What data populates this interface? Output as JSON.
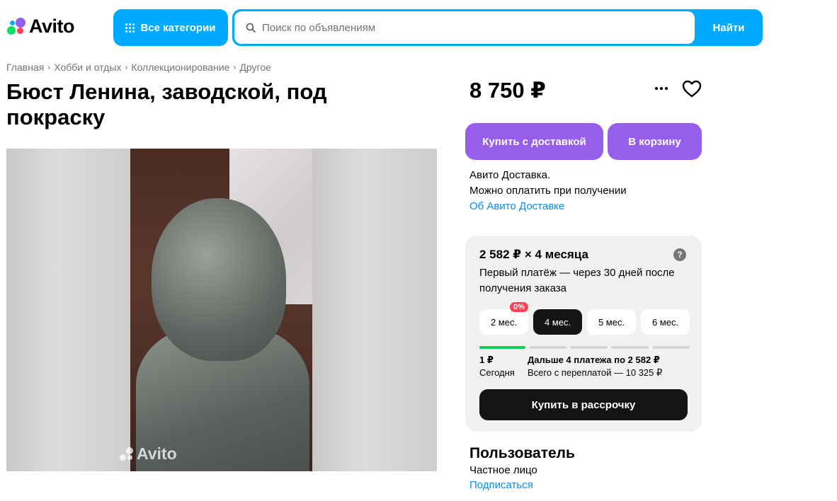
{
  "header": {
    "logo_text": "Avito",
    "categories_label": "Все категории",
    "search_placeholder": "Поиск по объявлениям",
    "find_label": "Найти",
    "accent_color": "#00aaff"
  },
  "breadcrumbs": [
    "Главная",
    "Хобби и отдых",
    "Коллекционирование",
    "Другое"
  ],
  "listing": {
    "title": "Бюст Ленина, заводской, под покраску",
    "price": "8 750 ₽",
    "photo_watermark": "Avito"
  },
  "actions": {
    "buy_delivery_label": "Купить с доставкой",
    "cart_label": "В корзину",
    "purple_color": "#965eeb"
  },
  "delivery": {
    "line1": "Авито Доставка.",
    "line2": "Можно оплатить при получении",
    "link": "Об Авито Доставке"
  },
  "installment": {
    "title": "2 582 ₽ × 4 месяца",
    "subtitle": "Первый платёж — через 30 дней после получения заказа",
    "help_icon_glyph": "?",
    "tabs": [
      {
        "label": "2 мес.",
        "badge": "0%"
      },
      {
        "label": "4 мес."
      },
      {
        "label": "5 мес."
      },
      {
        "label": "6 мес."
      }
    ],
    "active_tab": "4 мес.",
    "first_amount": "1 ₽",
    "first_when": "Сегодня",
    "rest_title": "Дальше 4 платежа по 2 582 ₽",
    "rest_total": "Всего с переплатой — 10 325 ₽",
    "buy_label": "Купить в рассрочку"
  },
  "seller": {
    "name": "Пользователь",
    "type": "Частное лицо",
    "subscribe": "Подписаться"
  }
}
